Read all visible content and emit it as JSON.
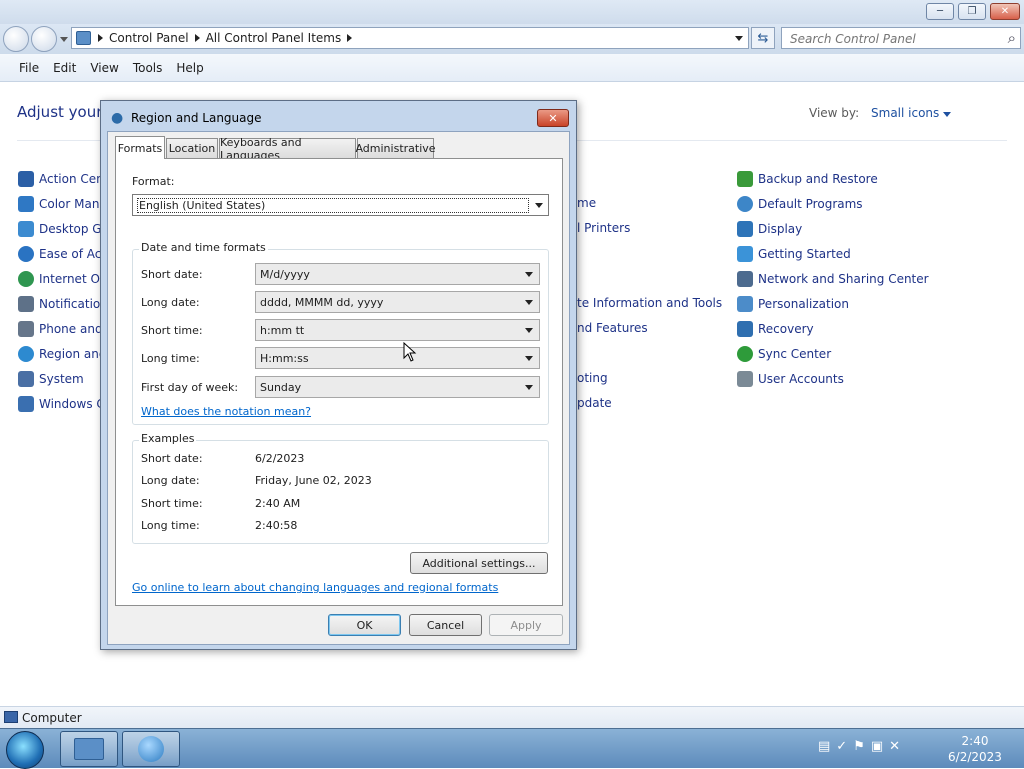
{
  "window": {
    "minimize_glyph": "─",
    "maximize_glyph": "❐",
    "close_glyph": "✕"
  },
  "address": {
    "crumbs": [
      "Control Panel",
      "All Control Panel Items"
    ],
    "search_placeholder": "Search Control Panel",
    "refresh_glyph": "⇆",
    "search_glyph": "⌕"
  },
  "menu": [
    "File",
    "Edit",
    "View",
    "Tools",
    "Help"
  ],
  "control_panel": {
    "heading": "Adjust your",
    "view_by_label": "View by:",
    "view_by_value": "Small icons",
    "left_items": [
      {
        "label": "Action Cent",
        "color": "#2b5fa6"
      },
      {
        "label": "Color Mana",
        "color": "#2f78c4"
      },
      {
        "label": "Desktop Ga",
        "color": "#3c8bd0"
      },
      {
        "label": "Ease of Acc",
        "color": "#2a73c2"
      },
      {
        "label": "Internet Opt",
        "color": "#2f9650"
      },
      {
        "label": "Notification",
        "color": "#5e7188"
      },
      {
        "label": "Phone and M",
        "color": "#66768a"
      },
      {
        "label": "Region and",
        "color": "#2d8ad0"
      },
      {
        "label": "System",
        "color": "#4a6fa4"
      },
      {
        "label": "Windows Ca",
        "color": "#3a6fb0"
      }
    ],
    "middle_items": [
      {
        "label": "me"
      },
      {
        "label": "l Printers"
      },
      {
        "label": "te Information and Tools"
      },
      {
        "label": "nd Features"
      },
      {
        "label": "oting"
      },
      {
        "label": "pdate"
      }
    ],
    "right_items": [
      {
        "label": "Backup and Restore",
        "color": "#3a9a3a"
      },
      {
        "label": "Default Programs",
        "color": "#3d86c8"
      },
      {
        "label": "Display",
        "color": "#2e74b8"
      },
      {
        "label": "Getting Started",
        "color": "#3b93d8"
      },
      {
        "label": "Network and Sharing Center",
        "color": "#4d6b8f"
      },
      {
        "label": "Personalization",
        "color": "#4c8cc9"
      },
      {
        "label": "Recovery",
        "color": "#2f6fb0"
      },
      {
        "label": "Sync Center",
        "color": "#2e9b3a"
      },
      {
        "label": "User Accounts",
        "color": "#7b8a96"
      }
    ]
  },
  "dialog": {
    "title": "Region and Language",
    "close_glyph": "✕",
    "tabs": [
      "Formats",
      "Location",
      "Keyboards and Languages",
      "Administrative"
    ],
    "format_label": "Format:",
    "format_value": "English (United States)",
    "datetime_group_title": "Date and time formats",
    "fields": [
      {
        "label": "Short date:",
        "value": "M/d/yyyy"
      },
      {
        "label": "Long date:",
        "value": "dddd, MMMM dd, yyyy"
      },
      {
        "label": "Short time:",
        "value": "h:mm tt"
      },
      {
        "label": "Long time:",
        "value": "H:mm:ss"
      },
      {
        "label": "First day of week:",
        "value": "Sunday"
      }
    ],
    "notation_link": "What does the notation mean?",
    "examples_group_title": "Examples",
    "examples": [
      {
        "label": "Short date:",
        "value": "6/2/2023"
      },
      {
        "label": "Long date:",
        "value": "Friday, June 02, 2023"
      },
      {
        "label": "Short time:",
        "value": "2:40 AM"
      },
      {
        "label": "Long time:",
        "value": "2:40:58"
      }
    ],
    "additional_settings": "Additional settings...",
    "online_link": "Go online to learn about changing languages and regional formats",
    "ok": "OK",
    "cancel": "Cancel",
    "apply": "Apply"
  },
  "statusbar": {
    "text": "Computer"
  },
  "taskbar": {
    "clock_time": "2:40",
    "clock_date": "6/2/2023"
  }
}
